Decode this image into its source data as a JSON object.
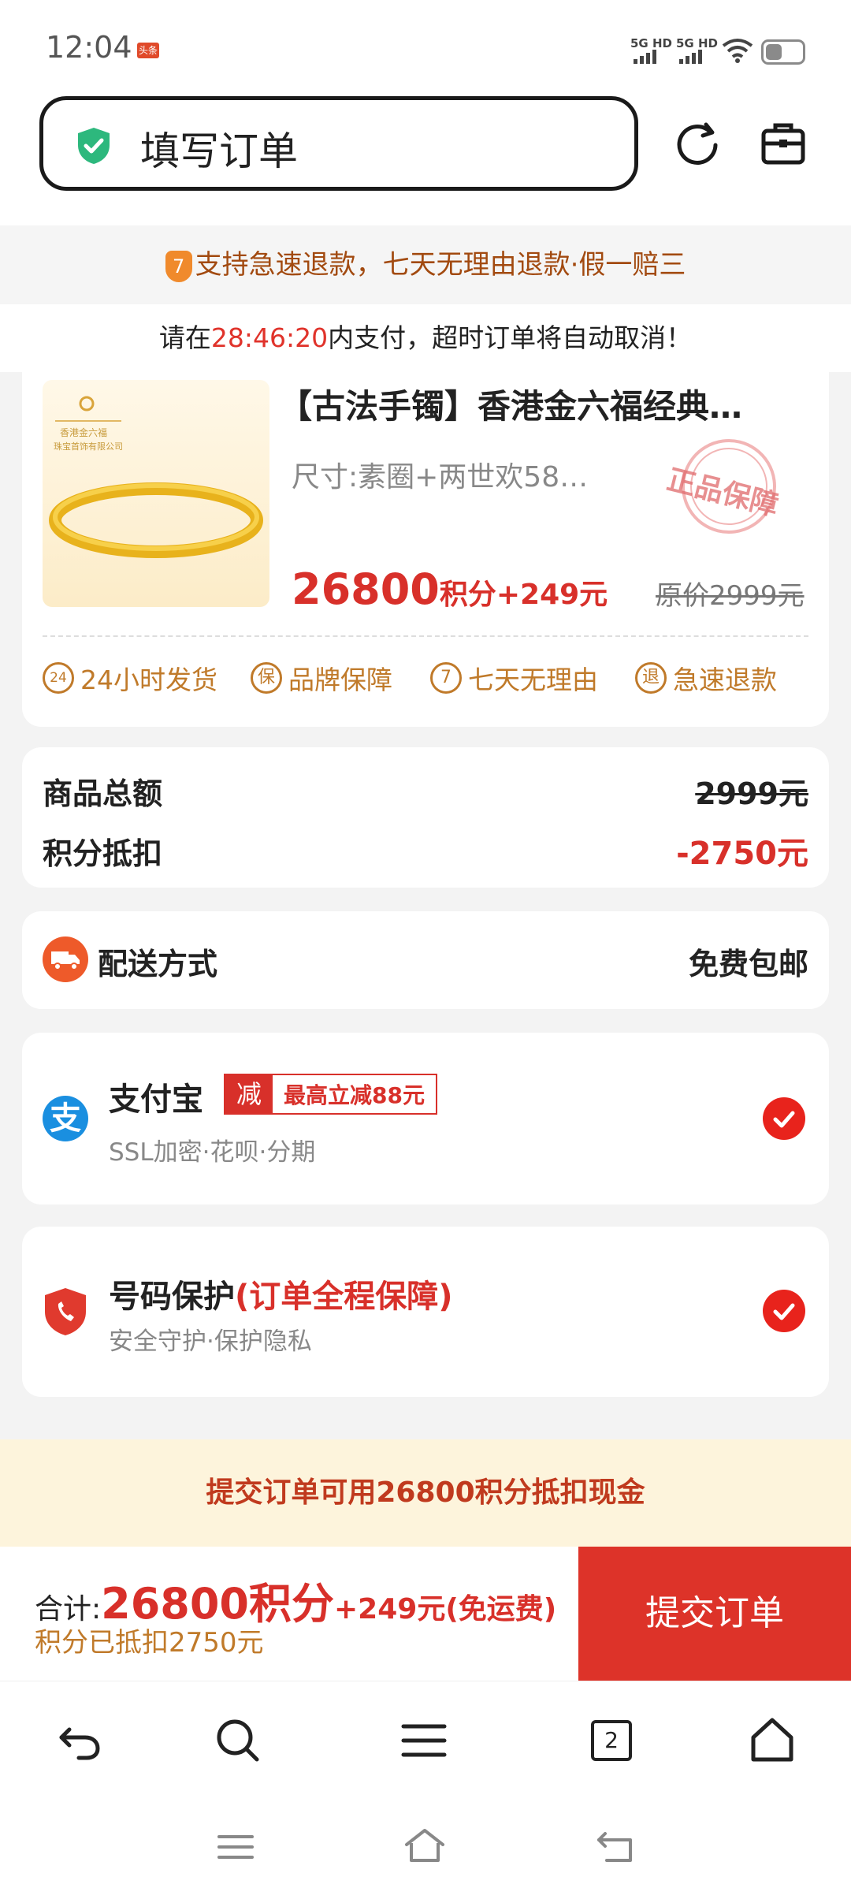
{
  "status_bar": {
    "time": "12:04",
    "app_badge": "头条",
    "sim1": "5G HD",
    "sim2": "5G HD"
  },
  "header": {
    "page_title": "填写订单",
    "shield_color": "#2db87d"
  },
  "notices": {
    "guarantee_badge": "7",
    "guarantee": "支持急速退款，七天无理由退款·假一赔三",
    "pay_prefix": "请在",
    "countdown": "28:46:20",
    "pay_suffix": "内支付，超时订单将自动取消！"
  },
  "product": {
    "image_brand": "香港金六福",
    "image_brand_sub": "珠宝首饰有限公司",
    "title": "【古法手镯】香港金六福经典…",
    "spec": "尺寸:素圈+两世欢58…",
    "stamp": "正品保障",
    "price_points": "26800",
    "price_suffix": "积分+249元",
    "original_price": "原价2999元",
    "services": [
      {
        "icon": "24",
        "label": "24小时发货"
      },
      {
        "icon": "保",
        "label": "品牌保障"
      },
      {
        "icon": "7",
        "label": "七天无理由"
      },
      {
        "icon": "退",
        "label": "急速退款"
      }
    ]
  },
  "summary": {
    "goods_total_label": "商品总额",
    "goods_total_value": "2999元",
    "points_deduct_label": "积分抵扣",
    "points_deduct_value": "-2750元"
  },
  "shipping": {
    "label": "配送方式",
    "value": "免费包邮"
  },
  "payment": {
    "name": "支付宝",
    "icon_glyph": "支",
    "promo_tag": "减",
    "promo_text": "最高立减88元",
    "desc": "SSL加密·花呗·分期"
  },
  "protection": {
    "name": "号码保护",
    "highlight": "(订单全程保障)",
    "desc": "安全守护·保护隐私"
  },
  "bonus_banner": "提交订单可用26800积分抵扣现金",
  "total": {
    "label": "合计:",
    "points": "26800积分",
    "rest": "+249元(免运费)",
    "deducted": "积分已抵扣2750元",
    "submit": "提交订单"
  },
  "browser_nav": {
    "tab_count": "2"
  },
  "colors": {
    "accent_red": "#d8302a",
    "gold": "#c07a2a",
    "banner_bg": "#fdf4dc"
  }
}
